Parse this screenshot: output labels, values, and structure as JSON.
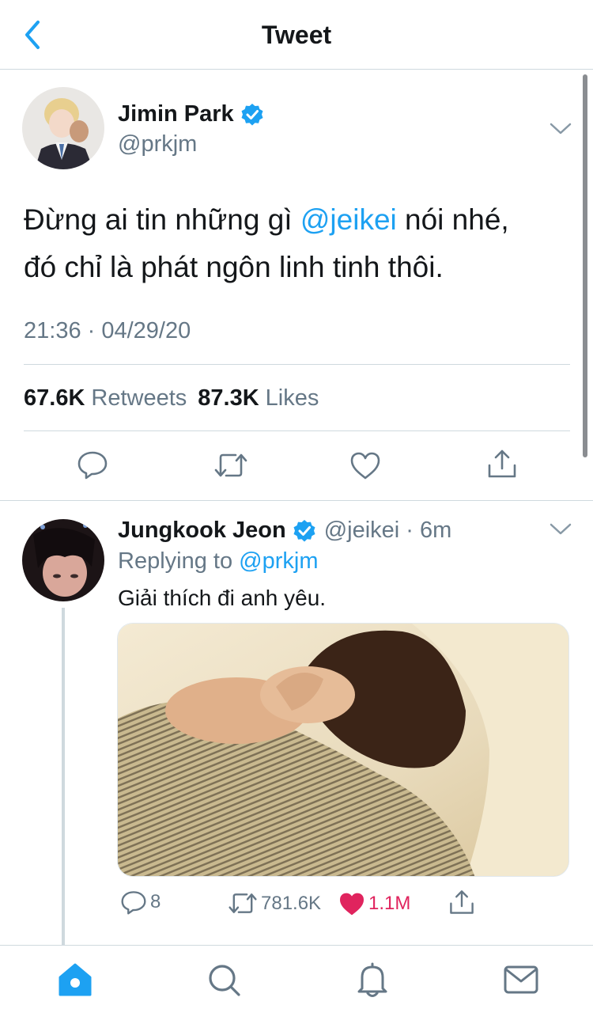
{
  "header": {
    "title": "Tweet"
  },
  "main_tweet": {
    "display_name": "Jimin Park",
    "handle": "@prkjm",
    "text_line1_before": "Đừng ai tin những gì ",
    "mention": "@jeikei",
    "text_line1_after": " nói nhé,",
    "text_line2": "đó chỉ là phát ngôn linh tinh thôi.",
    "timestamp": "21:36 · 04/29/20",
    "retweets_count": "67.6K",
    "retweets_label": "Retweets",
    "likes_count": "87.3K",
    "likes_label": "Likes"
  },
  "reply_tweet": {
    "display_name": "Jungkook Jeon",
    "handle_time": "@jeikei · 6m",
    "replying_prefix": "Replying to ",
    "replying_to": "@prkjm",
    "text": "Giải thích đi anh yêu.",
    "reply_count": "8",
    "retweet_count": "781.6K",
    "like_count": "1.1M"
  },
  "colors": {
    "accent": "#1da1f2",
    "like": "#e0245e",
    "muted": "#657786",
    "border": "#cfd9de"
  },
  "icons": {
    "back": "chevron-left-icon",
    "verified": "verified-badge-icon",
    "more": "chevron-down-icon",
    "reply": "reply-icon",
    "retweet": "retweet-icon",
    "like": "heart-icon",
    "share": "share-icon",
    "home": "home-icon",
    "search": "search-icon",
    "notifications": "bell-icon",
    "messages": "mail-icon"
  }
}
